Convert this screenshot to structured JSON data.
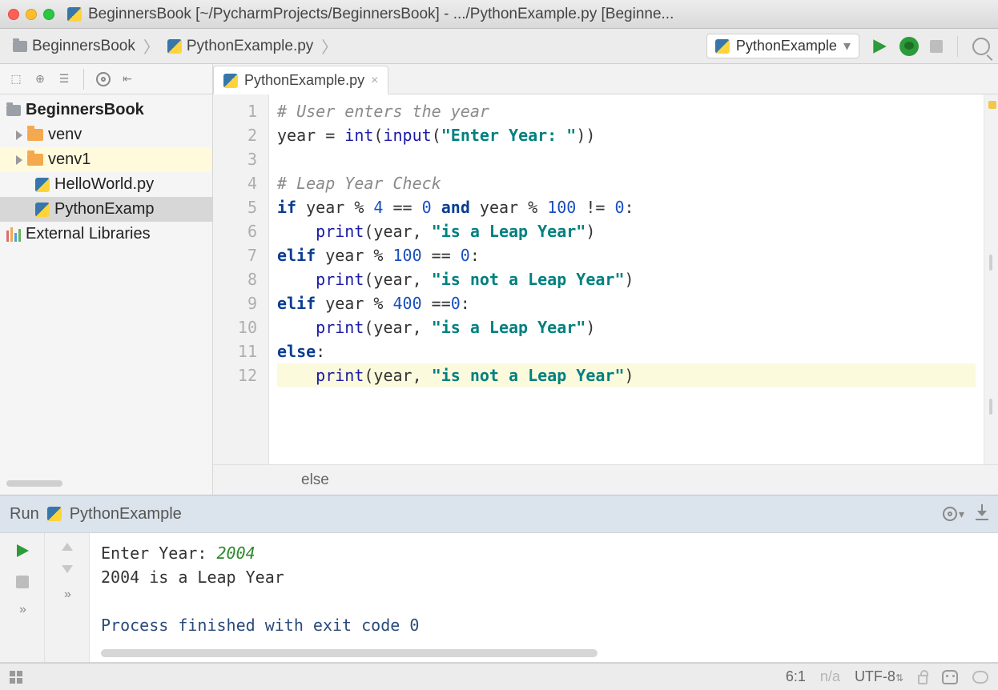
{
  "titlebar": {
    "title": "BeginnersBook [~/PycharmProjects/BeginnersBook] - .../PythonExample.py [Beginne..."
  },
  "breadcrumb": {
    "items": [
      "BeginnersBook",
      "PythonExample.py"
    ]
  },
  "run_config": {
    "name": "PythonExample"
  },
  "sidebar": {
    "project_root": "BeginnersBook",
    "items": [
      {
        "label": "venv",
        "kind": "folder"
      },
      {
        "label": "venv1",
        "kind": "folder"
      },
      {
        "label": "HelloWorld.py",
        "kind": "py"
      },
      {
        "label": "PythonExamp",
        "kind": "py",
        "selected": true
      }
    ],
    "external": "External Libraries"
  },
  "tabs": {
    "active": "PythonExample.py"
  },
  "code": {
    "lines_count": 12,
    "lines": [
      {
        "n": 1,
        "tokens": [
          [
            "comment",
            "# User enters the year"
          ]
        ]
      },
      {
        "n": 2,
        "tokens": [
          [
            "plain",
            "year = "
          ],
          [
            "builtin",
            "int"
          ],
          [
            "plain",
            "("
          ],
          [
            "builtin",
            "input"
          ],
          [
            "plain",
            "("
          ],
          [
            "str",
            "\"Enter Year: \""
          ],
          [
            "plain",
            "))"
          ]
        ]
      },
      {
        "n": 3,
        "tokens": []
      },
      {
        "n": 4,
        "tokens": [
          [
            "comment",
            "# Leap Year Check"
          ]
        ]
      },
      {
        "n": 5,
        "tokens": [
          [
            "kw",
            "if"
          ],
          [
            "plain",
            " year % "
          ],
          [
            "num",
            "4"
          ],
          [
            "plain",
            " == "
          ],
          [
            "num",
            "0"
          ],
          [
            "plain",
            " "
          ],
          [
            "kw",
            "and"
          ],
          [
            "plain",
            " year % "
          ],
          [
            "num",
            "100"
          ],
          [
            "plain",
            " != "
          ],
          [
            "num",
            "0"
          ],
          [
            "plain",
            ":"
          ]
        ]
      },
      {
        "n": 6,
        "tokens": [
          [
            "plain",
            "    "
          ],
          [
            "builtin",
            "print"
          ],
          [
            "plain",
            "(year, "
          ],
          [
            "str",
            "\"is a Leap Year\""
          ],
          [
            "plain",
            ")"
          ]
        ]
      },
      {
        "n": 7,
        "tokens": [
          [
            "kw",
            "elif"
          ],
          [
            "plain",
            " year % "
          ],
          [
            "num",
            "100"
          ],
          [
            "plain",
            " == "
          ],
          [
            "num",
            "0"
          ],
          [
            "plain",
            ":"
          ]
        ]
      },
      {
        "n": 8,
        "tokens": [
          [
            "plain",
            "    "
          ],
          [
            "builtin",
            "print"
          ],
          [
            "plain",
            "(year, "
          ],
          [
            "str",
            "\"is not a Leap Year\""
          ],
          [
            "plain",
            ")"
          ]
        ]
      },
      {
        "n": 9,
        "tokens": [
          [
            "kw",
            "elif"
          ],
          [
            "plain",
            " year % "
          ],
          [
            "num",
            "400"
          ],
          [
            "plain",
            " =="
          ],
          [
            "num",
            "0"
          ],
          [
            "plain",
            ":"
          ]
        ]
      },
      {
        "n": 10,
        "tokens": [
          [
            "plain",
            "    "
          ],
          [
            "builtin",
            "print"
          ],
          [
            "plain",
            "(year, "
          ],
          [
            "str",
            "\"is a Leap Year\""
          ],
          [
            "plain",
            ")"
          ]
        ]
      },
      {
        "n": 11,
        "tokens": [
          [
            "kw",
            "else"
          ],
          [
            "plain",
            ":"
          ]
        ]
      },
      {
        "n": 12,
        "tokens": [
          [
            "plain",
            "    "
          ],
          [
            "builtin",
            "print"
          ],
          [
            "plain",
            "(year, "
          ],
          [
            "str",
            "\"is not a Leap Year\""
          ],
          [
            "plain",
            ")"
          ]
        ],
        "highlight": true
      }
    ]
  },
  "code_crumb": "else",
  "run_panel": {
    "label": "Run",
    "config": "PythonExample",
    "prompt": "Enter Year: ",
    "input_value": "2004",
    "output_line": "2004 is a Leap Year",
    "exit_line": "Process finished with exit code 0"
  },
  "status": {
    "pos": "6:1",
    "na": "n/a",
    "encoding": "UTF-8"
  }
}
